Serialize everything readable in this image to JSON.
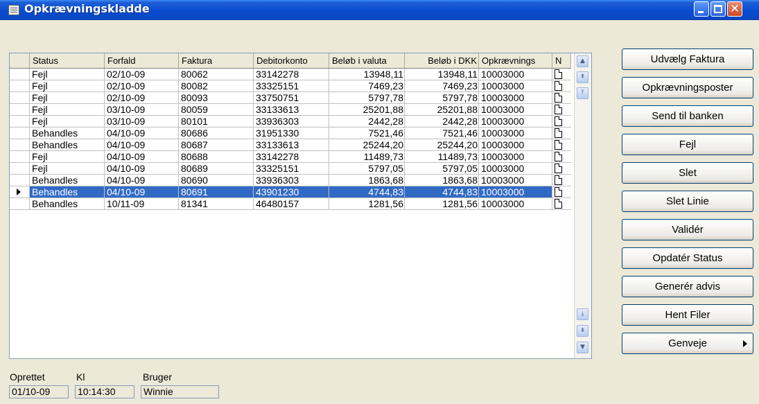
{
  "window": {
    "title": "Opkrævningskladde"
  },
  "grid": {
    "columns": [
      "Status",
      "Forfald",
      "Faktura",
      "Debitorkonto",
      "Beløb i valuta",
      "Beløb i DKK",
      "Opkrævnings",
      "N"
    ],
    "rows": [
      {
        "status": "Fejl",
        "forfald": "02/10-09",
        "faktura": "80062",
        "debitor": "33142278",
        "valuta": "13948,11",
        "dkk": "13948,11",
        "opk": "10003000"
      },
      {
        "status": "Fejl",
        "forfald": "02/10-09",
        "faktura": "80082",
        "debitor": "33325151",
        "valuta": "7469,23",
        "dkk": "7469,23",
        "opk": "10003000"
      },
      {
        "status": "Fejl",
        "forfald": "02/10-09",
        "faktura": "80093",
        "debitor": "33750751",
        "valuta": "5797,78",
        "dkk": "5797,78",
        "opk": "10003000"
      },
      {
        "status": "Fejl",
        "forfald": "03/10-09",
        "faktura": "80059",
        "debitor": "33133613",
        "valuta": "25201,88",
        "dkk": "25201,88",
        "opk": "10003000"
      },
      {
        "status": "Fejl",
        "forfald": "03/10-09",
        "faktura": "80101",
        "debitor": "33936303",
        "valuta": "2442,28",
        "dkk": "2442,28",
        "opk": "10003000"
      },
      {
        "status": "Behandles",
        "forfald": "04/10-09",
        "faktura": "80686",
        "debitor": "31951330",
        "valuta": "7521,46",
        "dkk": "7521,46",
        "opk": "10003000"
      },
      {
        "status": "Behandles",
        "forfald": "04/10-09",
        "faktura": "80687",
        "debitor": "33133613",
        "valuta": "25244,20",
        "dkk": "25244,20",
        "opk": "10003000"
      },
      {
        "status": "Fejl",
        "forfald": "04/10-09",
        "faktura": "80688",
        "debitor": "33142278",
        "valuta": "11489,73",
        "dkk": "11489,73",
        "opk": "10003000"
      },
      {
        "status": "Fejl",
        "forfald": "04/10-09",
        "faktura": "80689",
        "debitor": "33325151",
        "valuta": "5797,05",
        "dkk": "5797,05",
        "opk": "10003000"
      },
      {
        "status": "Behandles",
        "forfald": "04/10-09",
        "faktura": "80690",
        "debitor": "33936303",
        "valuta": "1863,68",
        "dkk": "1863,68",
        "opk": "10003000"
      },
      {
        "status": "Behandles",
        "forfald": "04/10-09",
        "faktura": "80691",
        "debitor": "43901230",
        "valuta": "4744,83",
        "dkk": "4744,83",
        "opk": "10003000",
        "selected": true
      },
      {
        "status": "Behandles",
        "forfald": "10/11-09",
        "faktura": "81341",
        "debitor": "46480157",
        "valuta": "1281,56",
        "dkk": "1281,56",
        "opk": "10003000"
      }
    ]
  },
  "buttons": [
    "Udvælg Faktura",
    "Opkrævningsposter",
    "Send til banken",
    "Fejl",
    "Slet",
    "Slet Linie",
    "Validér",
    "Opdatér Status",
    "Generér advis",
    "Hent Filer",
    "Genveje"
  ],
  "info": {
    "created_label": "Oprettet",
    "created_value": "01/10-09",
    "time_label": "Kl",
    "time_value": "10:14:30",
    "user_label": "Bruger",
    "user_value": "Winnie"
  },
  "colors": {
    "selection": "#316ac5",
    "titlebar": "#0a4cd0",
    "window_bg": "#ece9d8"
  }
}
